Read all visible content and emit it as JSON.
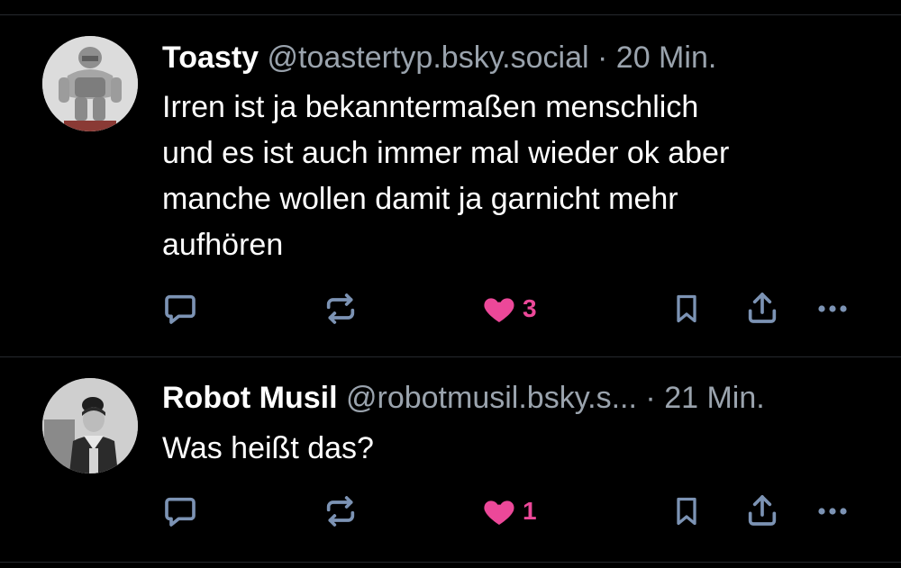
{
  "posts": [
    {
      "author_name": "Toasty",
      "author_handle": "@toastertyp.bsky.social",
      "separator": "·",
      "time": "20 Min.",
      "text": "Irren ist ja bekanntermaßen menschlich\nund es ist auch immer mal wieder ok aber\nmanche wollen damit ja garnicht mehr\naufhören",
      "like_count": "3",
      "liked": true
    },
    {
      "author_name": "Robot Musil",
      "author_handle": "@robotmusil.bsky.s...",
      "separator": "·",
      "time": "21 Min.",
      "text": "Was heißt das?",
      "like_count": "1",
      "liked": true
    }
  ],
  "actions": {
    "reply_icon": "reply-icon",
    "repost_icon": "repost-icon",
    "like_icon": "heart-icon",
    "bookmark_icon": "bookmark-icon",
    "share_icon": "share-icon",
    "more_icon": "more-icon"
  },
  "colors": {
    "background": "#000000",
    "text": "#ffffff",
    "muted": "#9aa3ad",
    "icon": "#7c93b4",
    "like": "#ec4899",
    "divider": "#26292e"
  }
}
